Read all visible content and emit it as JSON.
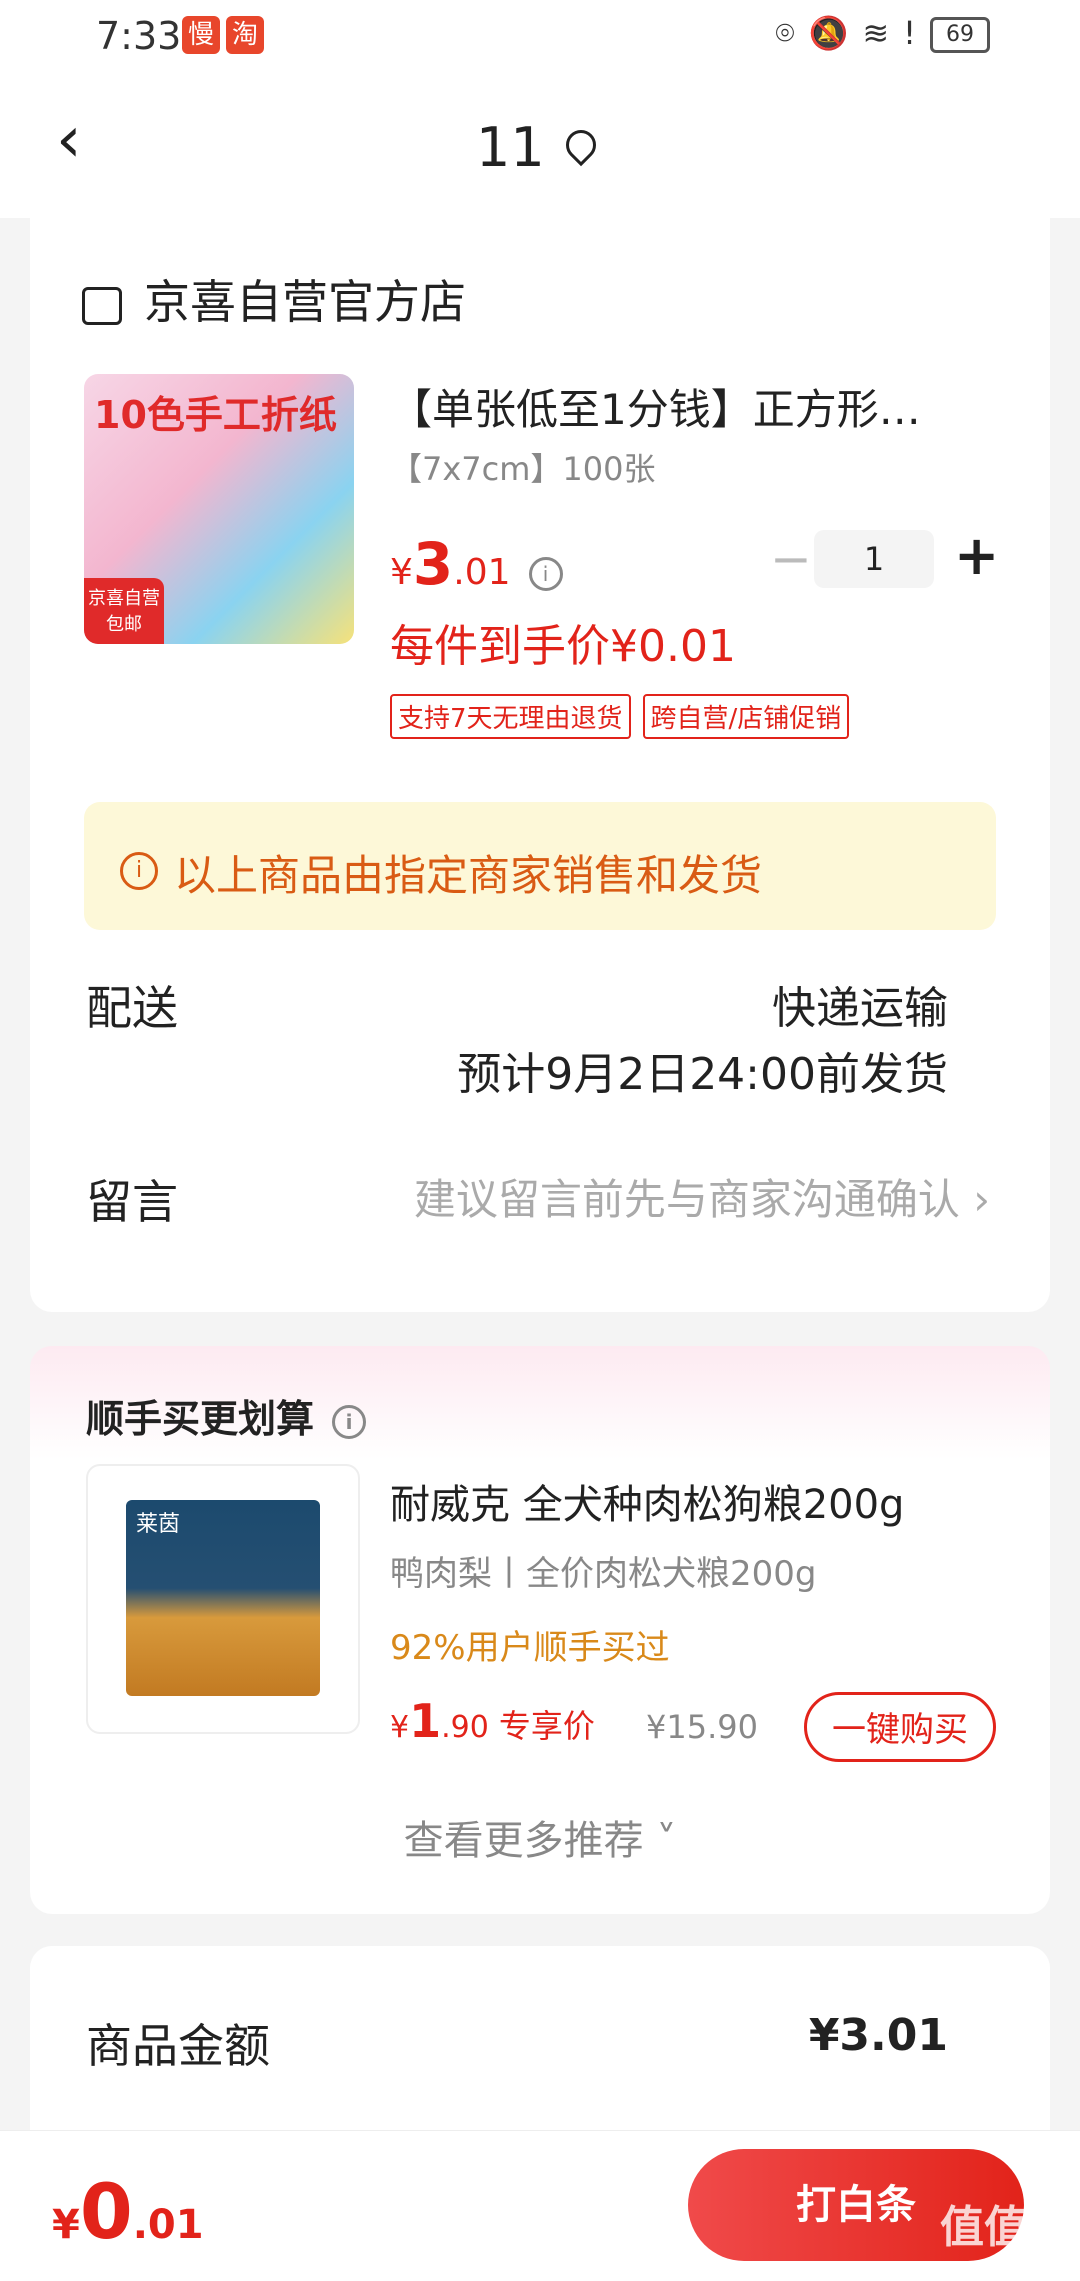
{
  "status_bar": {
    "time": "7:33",
    "badge1": "慢",
    "badge2": "淘",
    "battery": "69"
  },
  "header": {
    "title": "11"
  },
  "shop": {
    "name": "京喜自营官方店",
    "product": {
      "image_text": "10色手工折纸",
      "image_badge": "京喜自营 包邮",
      "title": "【单张低至1分钱】正方形…",
      "spec": "【7x7cm】100张",
      "currency": "¥",
      "price_int": "3",
      "price_dec": ".01",
      "quantity": "1",
      "minus": "−",
      "plus": "+",
      "per_item_price": "每件到手价¥0.01",
      "tags": [
        "支持7天无理由退货",
        "跨自营/店铺促销"
      ]
    },
    "notice": "以上商品由指定商家销售和发货",
    "delivery": {
      "label": "配送",
      "method": "快递运输",
      "eta": "预计9月2日24:00前发货"
    },
    "message": {
      "label": "留言",
      "hint": "建议留言前先与商家沟通确认 ›"
    }
  },
  "recommend": {
    "title": "顺手买更划算",
    "item": {
      "brand": "莱茵",
      "name": "耐威克 全犬种肉松狗粮200g",
      "subtitle": "鸭肉梨丨全价肉松犬粮200g",
      "popularity": "92%用户顺手买过",
      "currency": "¥",
      "price_int": "1",
      "price_dec": ".90",
      "price_label": "专享价",
      "original_price": "¥15.90",
      "buy_button": "一键购买"
    },
    "more": "查看更多推荐 ˅"
  },
  "summary": {
    "label": "商品金额",
    "value": "¥3.01"
  },
  "bottom_bar": {
    "currency": "¥",
    "total_int": "0",
    "total_dec": ".01",
    "pay_button": "打白条",
    "watermark": "值值值"
  }
}
